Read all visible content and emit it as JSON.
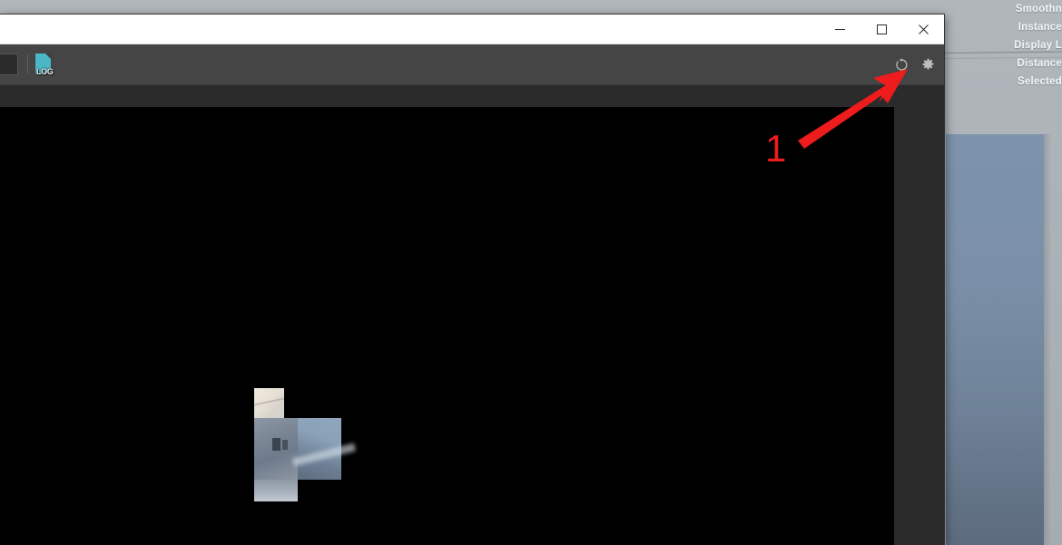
{
  "background_app": {
    "property_labels": [
      "Smoothn",
      "Instance",
      "Display L",
      "Distance",
      "Selected"
    ]
  },
  "window": {
    "titlebar": {
      "minimize_label": "Minimize",
      "maximize_label": "Maximize",
      "close_label": "Close",
      "minimize_icon": "minus-icon",
      "maximize_icon": "square-icon",
      "close_icon": "close-x-icon"
    },
    "toolbar": {
      "search_field_value": "",
      "log_button_label": "LOG",
      "log_icon": "log-document-icon",
      "refresh_icon": "refresh-circular-arrow-icon",
      "refresh_label": "Refresh",
      "settings_icon": "gear-icon",
      "settings_label": "Settings"
    },
    "canvas": {
      "background_color": "#000000",
      "thumbnail_state": "partially-loaded-tiles"
    }
  },
  "annotation": {
    "step_number": "1",
    "arrow_color": "#ee1c1c",
    "target": "refresh-button"
  },
  "colors": {
    "desktop_gray": "#aeb4b8",
    "window_chrome": "#454545",
    "subbar": "#2b2b2b",
    "canvas": "#000000",
    "log_accent": "#4ab6c6",
    "blue_panel": "#7d93ac",
    "annotation_red": "#ee1c1c"
  }
}
